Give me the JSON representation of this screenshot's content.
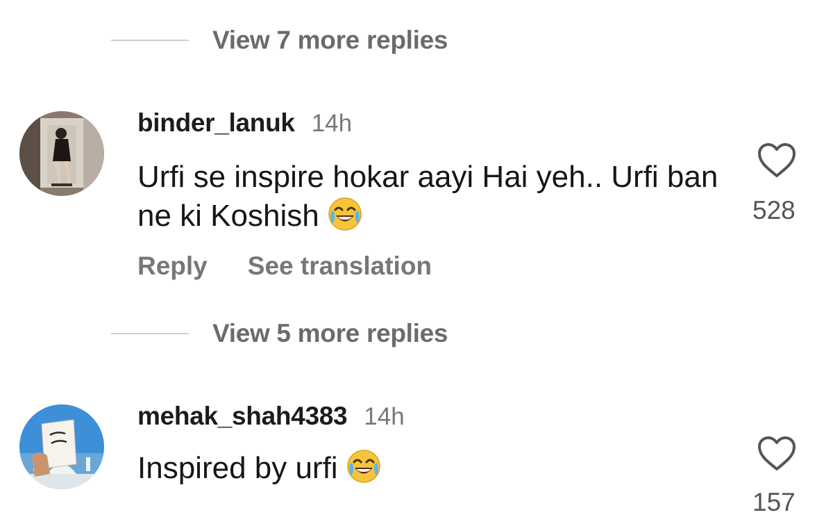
{
  "threads": [
    {
      "view_more_label": "View 7 more replies"
    },
    {
      "view_more_label": "View 5 more replies"
    }
  ],
  "comments": [
    {
      "username": "binder_lanuk",
      "time": "14h",
      "text": "Urfi se inspire hokar aayi Hai yeh.. Urfi ban ne ki Koshish",
      "emoji_icon": "face-with-tears-of-joy-icon",
      "like_count": "528",
      "actions": [
        "Reply",
        "See translation"
      ]
    },
    {
      "username": "mehak_shah4383",
      "time": "14h",
      "text": "Inspired by urfi",
      "emoji_icon": "face-with-tears-of-joy-icon",
      "like_count": "157"
    }
  ],
  "colors": {
    "secondary_text": "#6b6b6b",
    "divider": "#cfcfcf"
  }
}
